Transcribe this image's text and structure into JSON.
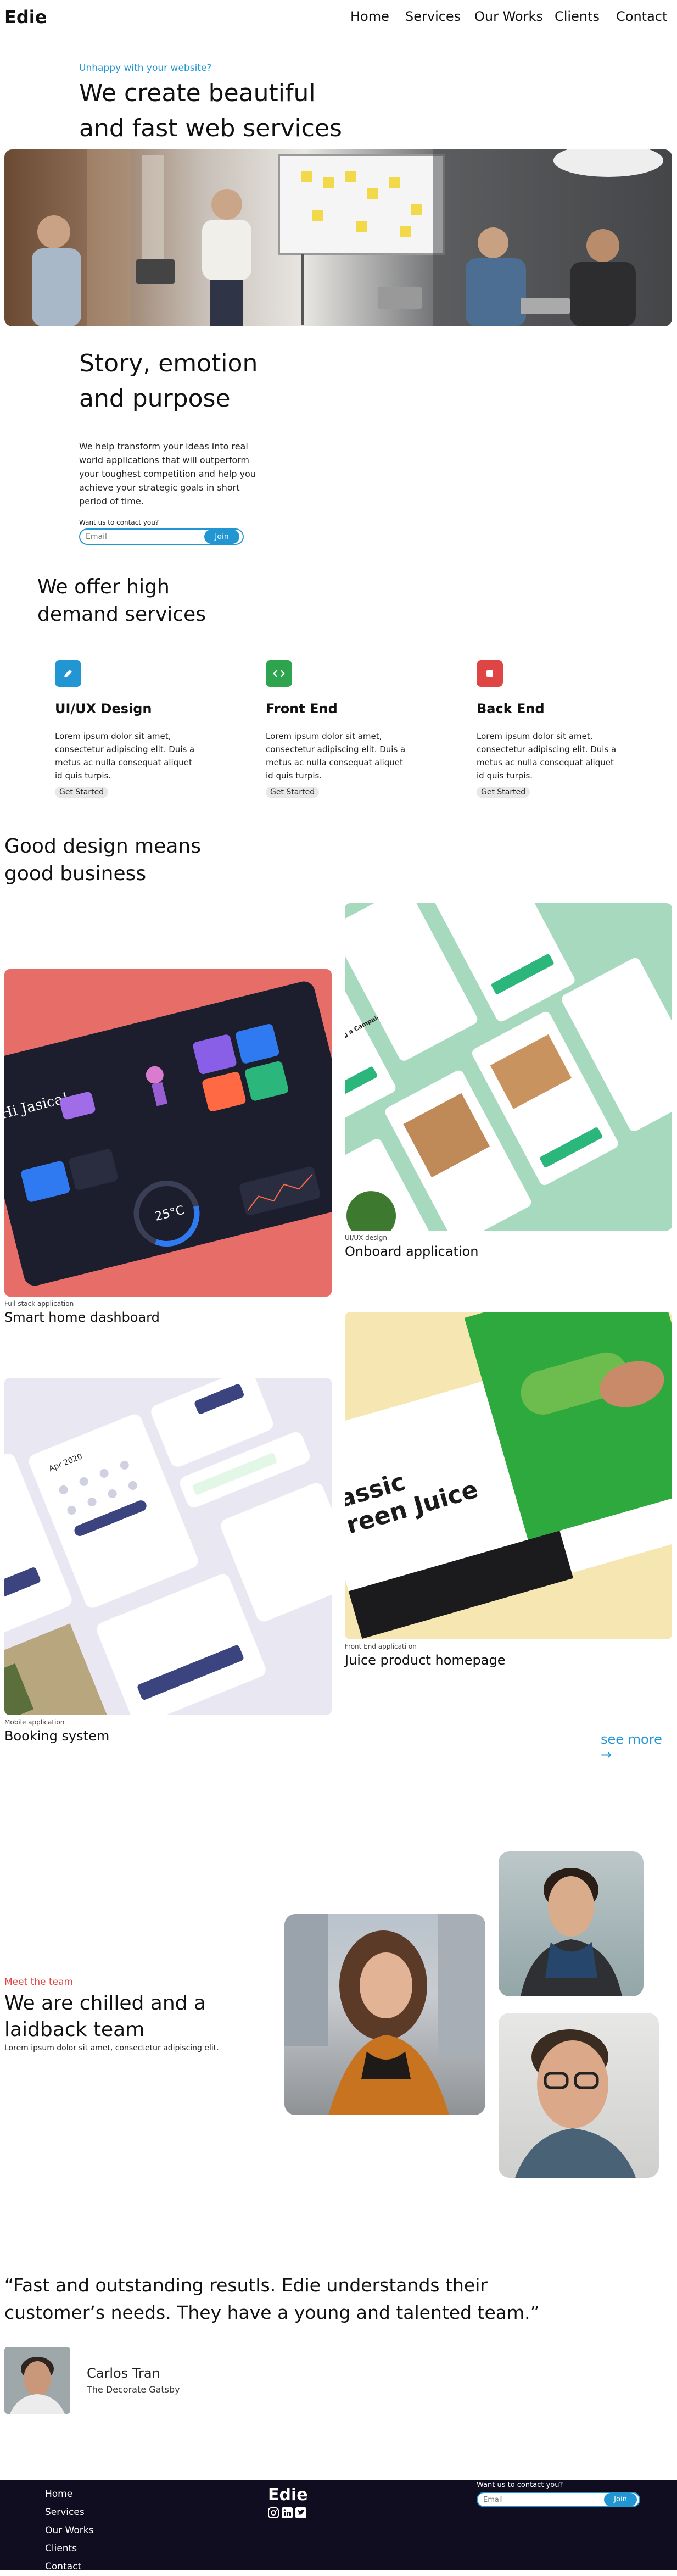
{
  "brand": "Edie",
  "nav": [
    "Home",
    "Services",
    "Our Works",
    "Clients",
    "Contact"
  ],
  "hero": {
    "eyebrow": "Unhappy with your website?",
    "title_line1": "We create beautiful",
    "title_line2": "and fast web services"
  },
  "story": {
    "title_line1": "Story, emotion",
    "title_line2": "and purpose",
    "body": "We help transform your ideas into real world applications that will outperform your toughest competition and help you achieve your strategic goals in short period of time.",
    "contact_label": "Want us to contact you?",
    "email_placeholder": "Email",
    "join": "Join"
  },
  "services": {
    "title_line1": "We offer high",
    "title_line2": "demand services",
    "items": [
      {
        "icon": "pencil-icon",
        "color": "#2196d3",
        "title": "UI/UX Design",
        "text": "Lorem ipsum dolor sit amet, consectetur adipiscing elit. Duis a metus ac nulla consequat aliquet id quis turpis.",
        "button": "Get Started"
      },
      {
        "icon": "code-icon",
        "color": "#2ea44f",
        "title": "Front End",
        "text": "Lorem ipsum dolor sit amet, consectetur adipiscing elit. Duis a metus ac nulla consequat aliquet id quis turpis.",
        "button": "Get Started"
      },
      {
        "icon": "square-icon",
        "color": "#e04545",
        "title": "Back End",
        "text": "Lorem ipsum dolor sit amet, consectetur adipiscing elit. Duis a metus ac nulla consequat aliquet id quis turpis.",
        "button": "Get Started"
      }
    ]
  },
  "works": {
    "title_line1": "Good design means",
    "title_line2": "good business",
    "projects": [
      {
        "caption": "Full stack application",
        "title": "Smart home dashboard"
      },
      {
        "caption": "UI/UX design",
        "title": "Onboard application"
      },
      {
        "caption": "Mobile application",
        "title": "Booking system"
      },
      {
        "caption": "Front End applicati on",
        "title": "Juice product homepage"
      }
    ],
    "see_more": "see more →"
  },
  "mockups": {
    "dashboard_greeting": "Hi Jasica!",
    "dashboard_temp": "25°C",
    "onboard_heading": "Start by Creating a Campaign",
    "juice_line1": "assic",
    "juice_line2": "reen Juice",
    "calendar_month": "Apr 2020"
  },
  "team": {
    "eyebrow": "Meet the team",
    "title_line1": "We are chilled and a",
    "title_line2": "laidback team",
    "body": "Lorem ipsum dolor sit amet, consectetur adipiscing elit."
  },
  "testimonial": {
    "quote_line1": "“Fast and outstanding resutls. Edie understands their",
    "quote_line2": "customer’s needs. They have a young and talented team.”",
    "name": "Carlos Tran",
    "company": "The Decorate Gatsby"
  },
  "footer": {
    "links": [
      "Home",
      "Services",
      "Our Works",
      "Clients",
      "Contact"
    ],
    "brand": "Edie",
    "contact_label": "Want us to contact you?",
    "email_placeholder": "Email",
    "join": "Join"
  },
  "colors": {
    "accent": "#2196d3",
    "eyebrow_red": "#e04545",
    "footer_bg": "#0f0d1f"
  }
}
